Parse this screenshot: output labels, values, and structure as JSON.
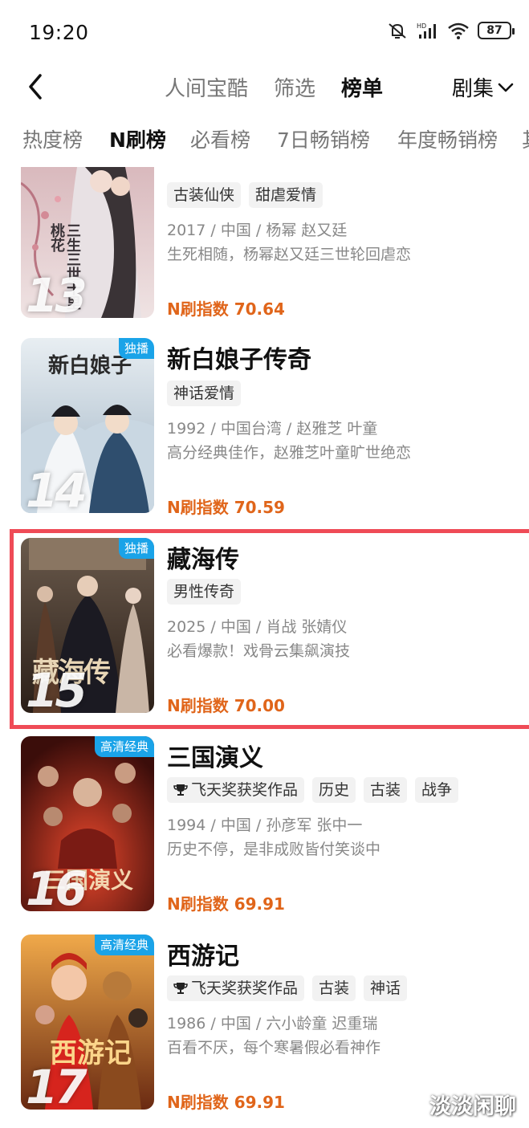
{
  "status": {
    "time": "19:20",
    "battery": "87"
  },
  "nav": {
    "tabs": [
      "人间宝酷",
      "筛选",
      "榜单"
    ],
    "active_tab": "榜单",
    "category": "剧集"
  },
  "rank_tabs": [
    "热度榜",
    "N刷榜",
    "必看榜",
    "7日畅销榜",
    "年度畅销榜",
    "其"
  ],
  "active_rank_tab": "N刷榜",
  "items": [
    {
      "rank": "13",
      "badge": "",
      "title": "",
      "tags": [
        "古装仙侠",
        "甜虐爱情"
      ],
      "meta": "2017 / 中国 / 杨幂 赵又廷",
      "desc": "生死相随，杨幂赵又廷三世轮回虐恋",
      "index": "N刷指数 70.64"
    },
    {
      "rank": "14",
      "badge": "独播",
      "title": "新白娘子传奇",
      "tags": [
        "神话爱情"
      ],
      "meta": "1992 / 中国台湾 / 赵雅芝 叶童",
      "desc": "高分经典佳作，赵雅芝叶童旷世绝恋",
      "index": "N刷指数 70.59"
    },
    {
      "rank": "15",
      "badge": "独播",
      "title": "藏海传",
      "tags": [
        "男性传奇"
      ],
      "meta": "2025 / 中国 / 肖战 张婧仪",
      "desc": "必看爆款！戏骨云集飙演技",
      "index": "N刷指数 70.00"
    },
    {
      "rank": "16",
      "badge": "高清经典",
      "title": "三国演义",
      "tags": [
        "飞天奖获奖作品",
        "历史",
        "古装",
        "战争"
      ],
      "meta": "1994 / 中国 / 孙彦军 张中一",
      "desc": "历史不停，是非成败皆付笑谈中",
      "index": "N刷指数 69.91"
    },
    {
      "rank": "17",
      "badge": "高清经典",
      "title": "西游记",
      "tags": [
        "飞天奖获奖作品",
        "古装",
        "神话"
      ],
      "meta": "1986 / 中国 / 六小龄童 迟重瑞",
      "desc": "百看不厌，每个寒暑假必看神作",
      "index": "N刷指数 69.91"
    }
  ],
  "poster_text": {
    "p13": "三生三世十里桃花",
    "p14": "新白娘子",
    "p15": "藏海传",
    "p16": "三国演义",
    "p17": "西游记"
  },
  "watermark": "淡淡闲聊",
  "colors": {
    "index": "#e0651a",
    "badge": "#1aa3e8",
    "highlight": "#ef4b57"
  }
}
